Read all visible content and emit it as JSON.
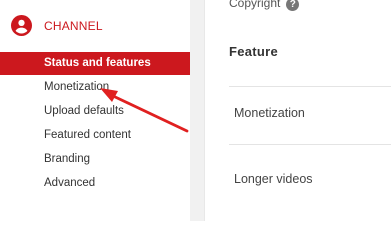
{
  "sidebar": {
    "title": "CHANNEL",
    "items": [
      {
        "label": "Status and features",
        "active": true
      },
      {
        "label": "Monetization",
        "active": false
      },
      {
        "label": "Upload defaults",
        "active": false
      },
      {
        "label": "Featured content",
        "active": false
      },
      {
        "label": "Branding",
        "active": false
      },
      {
        "label": "Advanced",
        "active": false
      }
    ]
  },
  "main": {
    "copyright_label": "Copyright",
    "help_icon_glyph": "?",
    "feature_heading": "Feature",
    "features": [
      {
        "label": "Monetization"
      },
      {
        "label": "Longer videos"
      }
    ]
  },
  "colors": {
    "accent": "#cc181e",
    "annotation_arrow": "#e02020"
  },
  "icons": {
    "channel": "person-icon",
    "help": "help-icon",
    "annotation": "arrow-annotation"
  }
}
